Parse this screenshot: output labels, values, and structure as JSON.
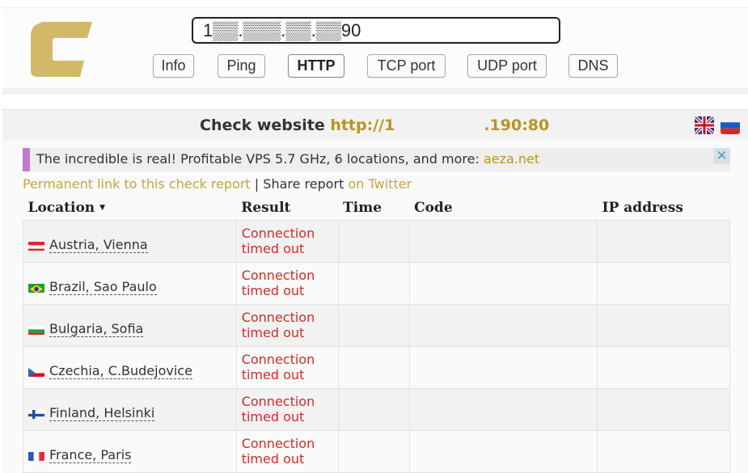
{
  "header": {
    "logo": "checkhost-logo",
    "host_value": "1▒▒.▒▒▒.▒▒.▒▒90",
    "nav": [
      {
        "label": "Info",
        "active": false
      },
      {
        "label": "Ping",
        "active": false
      },
      {
        "label": "HTTP",
        "active": true
      },
      {
        "label": "TCP port",
        "active": false
      },
      {
        "label": "UDP port",
        "active": false
      },
      {
        "label": "DNS",
        "active": false
      }
    ]
  },
  "main": {
    "title_prefix": "Check website",
    "title_url_start": "http://1",
    "title_url_end": ".190:80",
    "languages": [
      {
        "icon": "uk-flag-icon",
        "lang": "English"
      },
      {
        "icon": "russia-flag-icon",
        "lang": "Russian"
      }
    ],
    "promo": {
      "text": "The incredible is real! Profitable VPS 5.7 GHz, 6 locations, and more:",
      "link": "aeza.net",
      "close_icon": "close-icon"
    },
    "permalink": "Permanent link to this check report",
    "separator": "|",
    "share_text": "Share report",
    "share_link": "on Twitter",
    "table": {
      "headers": [
        "Location",
        "Result",
        "Time",
        "Code",
        "IP address"
      ],
      "rows": [
        {
          "country": "austria",
          "location": "Austria, Vienna",
          "result_line1": "Connection",
          "result_line2": "timed out",
          "time": "",
          "code": "",
          "ip": ""
        },
        {
          "country": "brazil",
          "location": "Brazil, Sao Paulo",
          "result_line1": "Connection",
          "result_line2": "timed out",
          "time": "",
          "code": "",
          "ip": ""
        },
        {
          "country": "bulgaria",
          "location": "Bulgaria, Sofia",
          "result_line1": "Connection",
          "result_line2": "timed out",
          "time": "",
          "code": "",
          "ip": ""
        },
        {
          "country": "czechia",
          "location": "Czechia, C.Budejovice",
          "result_line1": "Connection",
          "result_line2": "timed out",
          "time": "",
          "code": "",
          "ip": ""
        },
        {
          "country": "finland",
          "location": "Finland, Helsinki",
          "result_line1": "Connection",
          "result_line2": "timed out",
          "time": "",
          "code": "",
          "ip": ""
        },
        {
          "country": "france",
          "location": "France, Paris",
          "result_line1": "Connection",
          "result_line2": "timed out",
          "time": "",
          "code": "",
          "ip": ""
        }
      ]
    }
  },
  "colors": {
    "accent_gold": "#b8961e",
    "error_red": "#d42a2a",
    "promo_mark": "#c07ac8"
  }
}
